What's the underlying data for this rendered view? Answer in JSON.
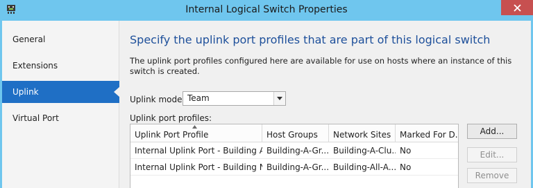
{
  "window": {
    "title": "Internal Logical Switch Properties"
  },
  "sidebar": {
    "items": [
      {
        "label": "General",
        "active": false
      },
      {
        "label": "Extensions",
        "active": false
      },
      {
        "label": "Uplink",
        "active": true
      },
      {
        "label": "Virtual Port",
        "active": false
      }
    ]
  },
  "main": {
    "heading": "Specify the uplink port profiles that are part of this logical switch",
    "description": "The uplink port profiles configured here are available for use on hosts where an instance of this switch is created.",
    "uplink_mode": {
      "label": "Uplink mode:",
      "value": "Team"
    },
    "profiles_label": "Uplink port profiles:",
    "table": {
      "columns": [
        "Uplink Port Profile",
        "Host Groups",
        "Network Sites",
        "Marked For D..."
      ],
      "rows": [
        [
          "Internal Uplink Port - Building A",
          "Building-A-Gr...",
          "Building-A-Clu...",
          "No"
        ],
        [
          "Internal Uplink Port - Building N",
          "Building-A-Gr...",
          "Building-All-A...",
          "No"
        ]
      ]
    },
    "buttons": {
      "add": "Add...",
      "edit": "Edit...",
      "remove": "Remove"
    }
  },
  "colors": {
    "accent": "#1f6fc5",
    "titlebar": "#6fc6ee",
    "heading": "#1d4f9a",
    "close": "#c75050"
  },
  "icons": {
    "app": "network-switch-icon",
    "close": "close-icon",
    "sort": "sort-ascending-icon",
    "dropdown": "chevron-down-icon"
  }
}
